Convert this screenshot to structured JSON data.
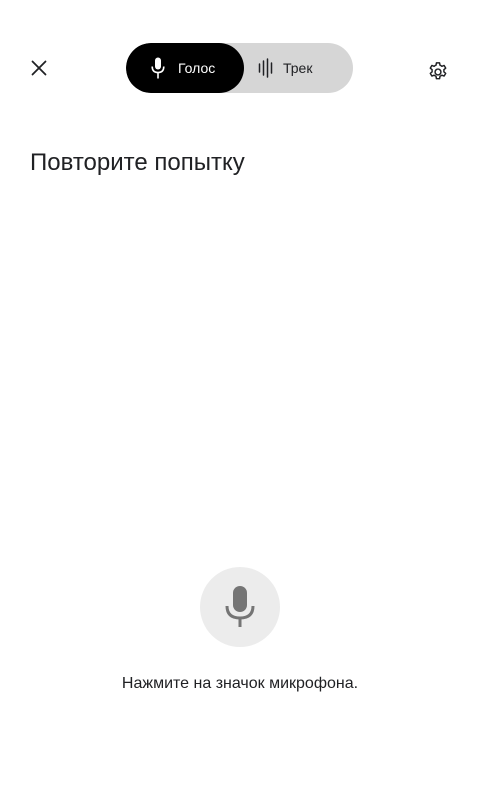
{
  "header": {
    "close_icon": "close-icon",
    "settings_icon": "gear-icon",
    "modes": [
      {
        "label": "Голос",
        "icon": "microphone-icon",
        "selected": true
      },
      {
        "label": "Трек",
        "icon": "waveform-icon",
        "selected": false
      }
    ]
  },
  "main": {
    "status_title": "Повторите попытку",
    "mic_icon": "microphone-icon",
    "hint": "Нажмите на значок микрофона."
  },
  "colors": {
    "selected_tab_bg": "#000000",
    "toggle_bg": "#d6d6d6",
    "mic_button_bg": "#ececec",
    "mic_icon": "#757575"
  }
}
